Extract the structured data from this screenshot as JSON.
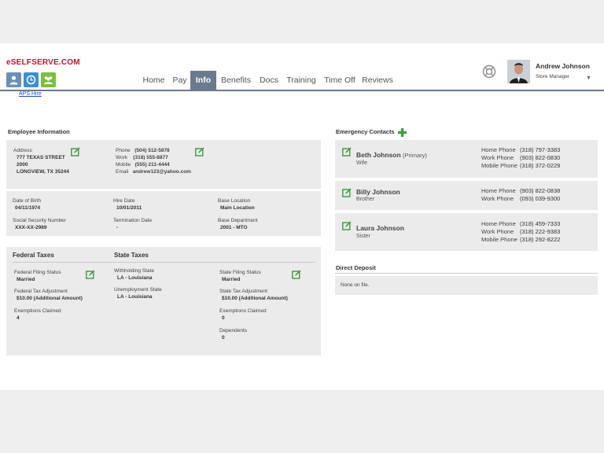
{
  "brand": "eSELFSERVE.COM",
  "aps_link": "APS Hire",
  "nav": {
    "tabs": [
      "Home",
      "Pay",
      "Info",
      "Benefits",
      "Docs",
      "Training",
      "Time Off",
      "Reviews"
    ],
    "active": "Info"
  },
  "user": {
    "name": "Andrew Johnson",
    "role": "Store Manager"
  },
  "employee_info": {
    "title": "Employee Information",
    "address_label": "Address",
    "address_line1": "777 TEXAS STREET",
    "address_line2": "2000",
    "address_line3": "LONGVIEW, TX 35244",
    "phone_label": "Phone",
    "phone": "(504) 512-5878",
    "work_label": "Work",
    "work": "(318) 555-8877",
    "mobile_label": "Mobile",
    "mobile": "(555) 211-4444",
    "email_label": "Email",
    "email": "andrew123@yahoo.com",
    "dob_label": "Date of Birth",
    "dob": "04/11/1974",
    "ssn_label": "Social Security Number",
    "ssn": "XXX-XX-2989",
    "hire_label": "Hire Date",
    "hire": "10/01/2011",
    "term_label": "Termination Date",
    "term": "-",
    "base_loc_label": "Base Location",
    "base_loc": "Main Location",
    "base_dept_label": "Base Department",
    "base_dept": "2001 - MTO"
  },
  "taxes": {
    "federal_title": "Federal Taxes",
    "state_title": "State Taxes",
    "fed_filing_label": "Federal Filing Status",
    "fed_filing": "Married",
    "fed_adj_label": "Federal Tax Adjustment",
    "fed_adj": "$10.00 (Additional Amount)",
    "fed_exempt_label": "Exemptions Claimed",
    "fed_exempt": "4",
    "withholding_label": "Withholding State",
    "withholding": "LA - Louisiana",
    "unemployment_label": "Unemployment State",
    "unemployment": "LA - Louisiana",
    "state_filing_label": "State Filing Status",
    "state_filing": "Married",
    "state_adj_label": "State Tax Adjustment",
    "state_adj": "$10.00 (Additional Amount)",
    "state_exempt_label": "Exemptions Claimed",
    "state_exempt": "0",
    "dependents_label": "Dependents",
    "dependents": "0"
  },
  "emergency": {
    "title": "Emergency Contacts",
    "contacts": [
      {
        "name": "Beth Johnson",
        "primary": "(Primary)",
        "relation": "Wife",
        "phones": [
          {
            "label": "Home Phone",
            "value": "(318) 797-3383"
          },
          {
            "label": "Work Phone",
            "value": "(903) 822-0830"
          },
          {
            "label": "Mobile Phone",
            "value": "(318) 372-0229"
          }
        ]
      },
      {
        "name": "Billy Johnson",
        "primary": "",
        "relation": "Brother",
        "phones": [
          {
            "label": "Home Phone",
            "value": "(903) 822-0838"
          },
          {
            "label": "Work Phone",
            "value": "(093) 039-9300"
          }
        ]
      },
      {
        "name": "Laura Johnson",
        "primary": "",
        "relation": "Sister",
        "phones": [
          {
            "label": "Home Phone",
            "value": "(318) 459-7333"
          },
          {
            "label": "Work Phone",
            "value": "(318) 222-9383"
          },
          {
            "label": "Mobile Phone",
            "value": "(318) 292-8222"
          }
        ]
      }
    ]
  },
  "direct_deposit": {
    "title": "Direct Deposit",
    "text": "None on file."
  },
  "colors": {
    "brand": "#c8102e",
    "nav_active": "#6b7a8c",
    "panel": "#ebebeb",
    "edit_green": "#3a9a3a"
  },
  "icons": [
    "user-icon",
    "clock-icon",
    "people-icon",
    "help-icon",
    "edit-icon",
    "plus-icon",
    "chevron-down-icon"
  ]
}
